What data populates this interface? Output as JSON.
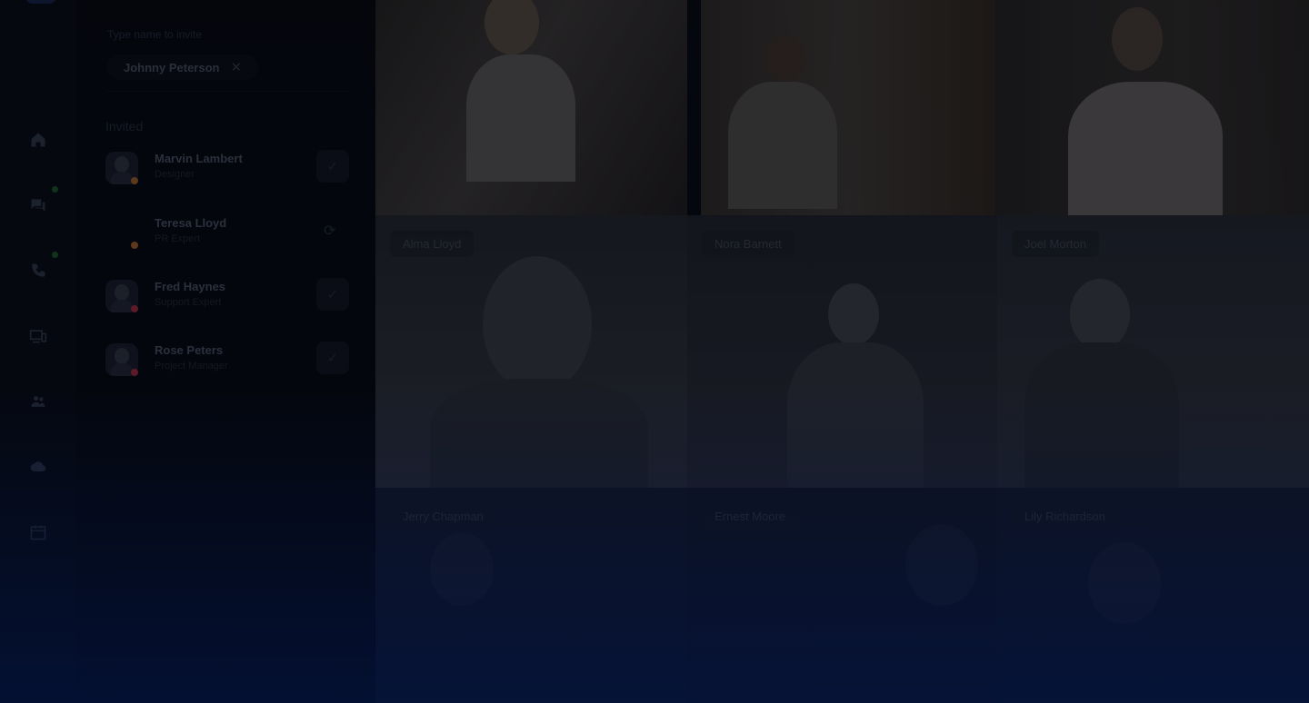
{
  "invite": {
    "label": "Type name to invite",
    "chip_name": "Johnny Peterson",
    "chip_close_icon": "close-icon"
  },
  "invited": {
    "title": "Invited",
    "people": [
      {
        "name": "Marvin Lambert",
        "role": "Designer",
        "status_color": "#c9762c",
        "state": "accepted",
        "avatar": true
      },
      {
        "name": "Teresa Lloyd",
        "role": "PR Expert",
        "status_color": "#c9762c",
        "state": "pending",
        "avatar": false
      },
      {
        "name": "Fred Haynes",
        "role": "Support Expert",
        "status_color": "#c9334a",
        "state": "accepted",
        "avatar": true
      },
      {
        "name": "Rose Peters",
        "role": "Project Manager",
        "status_color": "#c9334a",
        "state": "accepted",
        "avatar": true
      }
    ]
  },
  "rail": {
    "icons": [
      "home-icon",
      "chat-icon",
      "phone-icon",
      "devices-icon",
      "contacts-icon",
      "cloud-icon",
      "calendar-icon"
    ]
  },
  "participants": {
    "row2": [
      "Alma Lloyd",
      "Nora Barnett",
      "Joel Morton"
    ],
    "row3": [
      "Jerry Chapman",
      "Ernest Moore",
      "Lily Richardson"
    ]
  },
  "colors": {
    "accent": "#1b2a55",
    "status_online": "#1e6b2c",
    "gradient_bottom": "#03123a"
  }
}
